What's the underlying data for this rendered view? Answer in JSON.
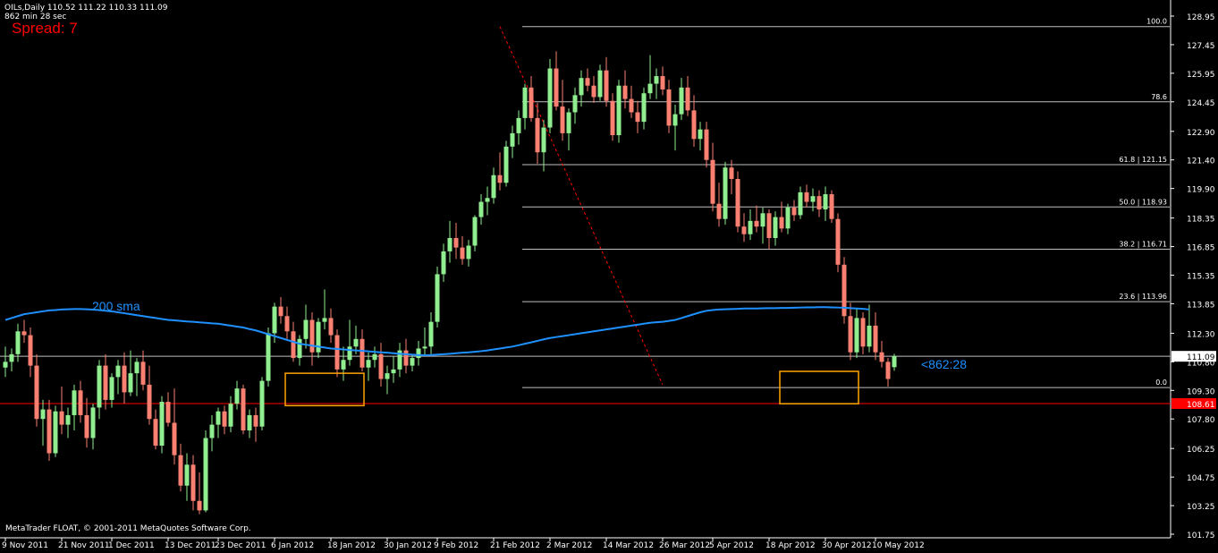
{
  "header": {
    "symbol_line": "OILs,Daily  110.52 111.22 110.33 111.09",
    "timer_line": "862 min 28 sec",
    "spread": "Spread: 7"
  },
  "footer": {
    "copyright": "MetaTrader FLOAT, © 2001-2011 MetaQuotes Software Corp."
  },
  "colors": {
    "background": "#000000",
    "axis": "#ffffff",
    "bull": "#90ee90",
    "bear": "#fa8072",
    "sma": "#1e90ff",
    "fib": "#c0c0c0",
    "trend": "#ff0000",
    "box": "#ffa500",
    "bid": "#c0c0c0",
    "ask_line": "#ff0000"
  },
  "chart_data": {
    "type": "candlestick",
    "symbol": "OILs",
    "timeframe": "Daily",
    "y_ticks": [
      "128.95",
      "127.45",
      "125.95",
      "124.45",
      "122.90",
      "121.40",
      "119.90",
      "118.35",
      "116.85",
      "115.35",
      "113.85",
      "112.30",
      "110.80",
      "109.30",
      "107.80",
      "106.25",
      "104.75",
      "103.25",
      "101.75"
    ],
    "ylim": [
      101.75,
      128.95
    ],
    "x_labels": [
      "9 Nov 2011",
      "21 Nov 2011",
      "1 Dec 2011",
      "13 Dec 2011",
      "23 Dec 2011",
      "6 Jan 2012",
      "18 Jan 2012",
      "30 Jan 2012",
      "9 Feb 2012",
      "21 Feb 2012",
      "2 Mar 2012",
      "14 Mar 2012",
      "26 Mar 2012",
      "5 Apr 2012",
      "18 Apr 2012",
      "30 Apr 2012",
      "10 May 2012"
    ],
    "x_label_index": [
      0,
      9,
      17,
      26,
      34,
      43,
      52,
      61,
      69,
      78,
      87,
      96,
      105,
      113,
      122,
      131,
      139
    ],
    "candles": [
      [
        110.5,
        111.6,
        110.0,
        110.8
      ],
      [
        110.8,
        111.5,
        110.3,
        111.2
      ],
      [
        111.2,
        112.8,
        110.8,
        112.4
      ],
      [
        112.4,
        113.0,
        111.8,
        112.2
      ],
      [
        112.2,
        112.6,
        110.0,
        110.6
      ],
      [
        110.6,
        111.2,
        107.4,
        107.8
      ],
      [
        107.8,
        108.8,
        106.4,
        108.3
      ],
      [
        108.3,
        108.8,
        105.6,
        106.0
      ],
      [
        106.0,
        108.5,
        105.8,
        108.2
      ],
      [
        108.2,
        109.5,
        107.0,
        107.5
      ],
      [
        107.5,
        108.4,
        106.8,
        108.0
      ],
      [
        108.0,
        109.6,
        107.2,
        109.3
      ],
      [
        109.3,
        109.8,
        107.6,
        108.0
      ],
      [
        108.0,
        108.9,
        106.3,
        106.8
      ],
      [
        106.8,
        108.6,
        106.2,
        108.4
      ],
      [
        108.4,
        110.9,
        107.8,
        110.6
      ],
      [
        110.6,
        111.2,
        108.3,
        108.8
      ],
      [
        108.8,
        110.2,
        108.4,
        110.0
      ],
      [
        110.0,
        110.9,
        109.1,
        110.6
      ],
      [
        110.6,
        111.3,
        108.6,
        109.2
      ],
      [
        109.2,
        111.4,
        109.0,
        110.2
      ],
      [
        110.2,
        111.0,
        109.0,
        110.8
      ],
      [
        110.8,
        111.4,
        109.3,
        109.6
      ],
      [
        109.6,
        110.6,
        107.5,
        107.8
      ],
      [
        107.8,
        108.3,
        106.2,
        106.4
      ],
      [
        106.4,
        109.0,
        106.0,
        108.7
      ],
      [
        108.7,
        109.2,
        107.4,
        107.6
      ],
      [
        107.6,
        109.4,
        105.4,
        105.9
      ],
      [
        105.9,
        106.5,
        104.0,
        104.3
      ],
      [
        104.3,
        106.0,
        103.5,
        105.4
      ],
      [
        105.4,
        105.9,
        103.0,
        103.5
      ],
      [
        103.5,
        105.0,
        102.8,
        103.0
      ],
      [
        103.0,
        107.2,
        102.9,
        106.8
      ],
      [
        106.8,
        108.0,
        106.1,
        107.5
      ],
      [
        107.5,
        108.4,
        106.8,
        108.2
      ],
      [
        108.2,
        108.5,
        107.0,
        107.4
      ],
      [
        107.4,
        109.0,
        107.1,
        108.6
      ],
      [
        108.6,
        109.8,
        108.3,
        109.4
      ],
      [
        109.4,
        109.6,
        107.0,
        107.2
      ],
      [
        107.2,
        108.3,
        106.8,
        108.0
      ],
      [
        108.0,
        108.4,
        106.6,
        107.4
      ],
      [
        107.4,
        110.0,
        107.2,
        109.8
      ],
      [
        109.8,
        112.6,
        109.5,
        112.3
      ],
      [
        112.3,
        113.9,
        111.8,
        113.7
      ],
      [
        113.7,
        114.2,
        112.8,
        113.2
      ],
      [
        113.2,
        113.7,
        112.0,
        112.4
      ],
      [
        112.4,
        112.9,
        110.8,
        111.0
      ],
      [
        111.0,
        112.2,
        110.6,
        112.0
      ],
      [
        112.0,
        113.8,
        111.5,
        113.0
      ],
      [
        113.0,
        113.4,
        110.6,
        111.3
      ],
      [
        111.3,
        113.1,
        111.0,
        112.9
      ],
      [
        112.9,
        114.6,
        112.5,
        113.1
      ],
      [
        113.1,
        113.6,
        111.8,
        112.2
      ],
      [
        112.2,
        112.5,
        110.0,
        110.4
      ],
      [
        110.4,
        111.6,
        109.8,
        110.9
      ],
      [
        110.9,
        113.0,
        110.6,
        111.6
      ],
      [
        111.6,
        112.7,
        111.2,
        112.0
      ],
      [
        112.0,
        112.5,
        110.3,
        110.5
      ],
      [
        110.5,
        111.3,
        109.8,
        110.9
      ],
      [
        110.9,
        111.6,
        110.5,
        111.2
      ],
      [
        111.2,
        111.8,
        109.5,
        109.9
      ],
      [
        109.9,
        110.6,
        109.1,
        110.2
      ],
      [
        110.2,
        111.1,
        109.7,
        110.4
      ],
      [
        110.4,
        111.8,
        110.0,
        111.4
      ],
      [
        111.4,
        112.0,
        110.2,
        110.6
      ],
      [
        110.6,
        111.2,
        110.3,
        111.0
      ],
      [
        111.0,
        111.9,
        110.6,
        111.5
      ],
      [
        111.5,
        112.6,
        111.1,
        111.6
      ],
      [
        111.6,
        113.4,
        111.2,
        112.9
      ],
      [
        112.9,
        115.8,
        112.6,
        115.4
      ],
      [
        115.4,
        117.0,
        115.0,
        116.6
      ],
      [
        116.6,
        118.2,
        116.0,
        117.3
      ],
      [
        117.3,
        118.1,
        116.2,
        116.8
      ],
      [
        116.8,
        117.4,
        115.9,
        116.2
      ],
      [
        116.2,
        117.2,
        115.8,
        116.9
      ],
      [
        116.9,
        118.5,
        116.6,
        118.4
      ],
      [
        118.4,
        119.6,
        118.0,
        119.2
      ],
      [
        119.2,
        120.0,
        118.5,
        119.4
      ],
      [
        119.4,
        121.0,
        119.1,
        120.6
      ],
      [
        120.6,
        121.8,
        119.8,
        120.2
      ],
      [
        120.2,
        122.4,
        120.0,
        122.1
      ],
      [
        122.1,
        123.2,
        121.5,
        122.8
      ],
      [
        122.8,
        124.0,
        122.2,
        123.6
      ],
      [
        123.6,
        125.4,
        123.0,
        125.2
      ],
      [
        125.2,
        125.8,
        123.4,
        123.6
      ],
      [
        123.6,
        124.4,
        121.2,
        121.8
      ],
      [
        121.8,
        123.5,
        120.8,
        123.1
      ],
      [
        123.1,
        126.7,
        122.8,
        126.2
      ],
      [
        126.2,
        127.1,
        124.0,
        124.2
      ],
      [
        124.2,
        125.6,
        122.4,
        122.8
      ],
      [
        122.8,
        124.1,
        121.9,
        123.9
      ],
      [
        123.9,
        125.2,
        123.3,
        124.8
      ],
      [
        124.8,
        126.1,
        124.2,
        125.7
      ],
      [
        125.7,
        126.2,
        125.0,
        125.3
      ],
      [
        125.3,
        125.8,
        124.4,
        124.7
      ],
      [
        124.7,
        126.4,
        124.5,
        126.1
      ],
      [
        126.1,
        126.8,
        124.2,
        124.5
      ],
      [
        124.5,
        124.9,
        122.4,
        122.7
      ],
      [
        122.7,
        125.6,
        122.3,
        125.3
      ],
      [
        125.3,
        126.1,
        124.1,
        124.6
      ],
      [
        124.6,
        125.3,
        123.6,
        123.9
      ],
      [
        123.9,
        124.5,
        122.8,
        123.4
      ],
      [
        123.4,
        125.2,
        123.0,
        124.9
      ],
      [
        124.9,
        126.9,
        124.6,
        125.4
      ],
      [
        125.4,
        126.2,
        124.6,
        125.8
      ],
      [
        125.8,
        126.3,
        124.8,
        125.1
      ],
      [
        125.1,
        125.6,
        122.8,
        123.2
      ],
      [
        123.2,
        124.3,
        121.9,
        123.8
      ],
      [
        123.8,
        125.7,
        123.5,
        125.2
      ],
      [
        125.2,
        125.8,
        123.7,
        124.0
      ],
      [
        124.0,
        124.8,
        122.1,
        122.5
      ],
      [
        122.5,
        123.4,
        121.9,
        123.0
      ],
      [
        123.0,
        123.4,
        121.0,
        121.4
      ],
      [
        121.4,
        122.3,
        118.7,
        119.1
      ],
      [
        119.1,
        120.2,
        117.9,
        118.3
      ],
      [
        118.3,
        121.3,
        118.0,
        121.0
      ],
      [
        121.0,
        121.4,
        119.6,
        120.4
      ],
      [
        120.4,
        120.8,
        117.6,
        117.9
      ],
      [
        117.9,
        118.6,
        117.1,
        117.5
      ],
      [
        117.5,
        118.8,
        117.2,
        118.2
      ],
      [
        118.2,
        119.0,
        117.6,
        117.9
      ],
      [
        117.9,
        118.9,
        117.0,
        118.6
      ],
      [
        118.6,
        118.8,
        116.7,
        117.3
      ],
      [
        117.3,
        118.7,
        116.9,
        118.4
      ],
      [
        118.4,
        119.2,
        117.6,
        117.8
      ],
      [
        117.8,
        119.1,
        117.5,
        118.9
      ],
      [
        118.9,
        119.3,
        118.2,
        118.5
      ],
      [
        118.5,
        120.0,
        118.3,
        119.7
      ],
      [
        119.7,
        120.1,
        118.9,
        119.2
      ],
      [
        119.2,
        119.9,
        118.7,
        119.5
      ],
      [
        119.5,
        119.8,
        118.4,
        118.8
      ],
      [
        118.8,
        120.0,
        118.2,
        119.6
      ],
      [
        119.6,
        119.8,
        118.1,
        118.3
      ],
      [
        118.3,
        118.6,
        115.5,
        115.9
      ],
      [
        115.9,
        116.3,
        112.8,
        113.2
      ],
      [
        113.2,
        113.9,
        110.9,
        111.3
      ],
      [
        111.3,
        113.6,
        111.0,
        113.1
      ],
      [
        113.1,
        113.4,
        111.2,
        111.6
      ],
      [
        111.6,
        113.8,
        111.3,
        112.7
      ],
      [
        112.7,
        113.4,
        110.9,
        111.3
      ],
      [
        111.3,
        111.9,
        110.5,
        110.8
      ],
      [
        110.8,
        111.0,
        109.5,
        109.9
      ],
      [
        110.52,
        111.22,
        110.33,
        111.09
      ]
    ],
    "sma": {
      "label": "200 sma",
      "values": [
        113.0,
        113.1,
        113.2,
        113.3,
        113.35,
        113.4,
        113.45,
        113.5,
        113.52,
        113.55,
        113.56,
        113.57,
        113.57,
        113.56,
        113.54,
        113.52,
        113.48,
        113.45,
        113.4,
        113.35,
        113.3,
        113.25,
        113.2,
        113.15,
        113.1,
        113.05,
        113.0,
        112.98,
        112.95,
        112.92,
        112.9,
        112.87,
        112.85,
        112.82,
        112.8,
        112.75,
        112.7,
        112.65,
        112.6,
        112.52,
        112.45,
        112.35,
        112.25,
        112.15,
        112.05,
        111.95,
        111.85,
        111.75,
        111.7,
        111.65,
        111.6,
        111.55,
        111.5,
        111.48,
        111.45,
        111.42,
        111.4,
        111.38,
        111.35,
        111.32,
        111.3,
        111.28,
        111.25,
        111.22,
        111.2,
        111.18,
        111.15,
        111.15,
        111.16,
        111.18,
        111.2,
        111.22,
        111.25,
        111.28,
        111.3,
        111.33,
        111.36,
        111.4,
        111.45,
        111.5,
        111.55,
        111.6,
        111.67,
        111.75,
        111.82,
        111.9,
        111.98,
        112.05,
        112.1,
        112.15,
        112.2,
        112.25,
        112.3,
        112.35,
        112.4,
        112.45,
        112.5,
        112.55,
        112.6,
        112.65,
        112.7,
        112.75,
        112.8,
        112.85,
        112.88,
        112.9,
        112.95,
        113.0,
        113.1,
        113.2,
        113.3,
        113.4,
        113.48,
        113.52,
        113.55,
        113.56,
        113.57,
        113.58,
        113.6,
        113.6,
        113.6,
        113.61,
        113.62,
        113.62,
        113.63,
        113.63,
        113.64,
        113.65,
        113.66,
        113.66,
        113.67,
        113.67,
        113.66,
        113.65,
        113.64,
        113.62,
        113.6,
        113.58,
        113.55
      ]
    },
    "fibonacci": [
      {
        "label": "100.0",
        "price": 128.4
      },
      {
        "label": "78.6",
        "price": 124.45
      },
      {
        "label": "61.8 | 121.15",
        "price": 121.15
      },
      {
        "label": "50.0 | 118.93",
        "price": 118.93
      },
      {
        "label": "38.2 | 116.71",
        "price": 116.71
      },
      {
        "label": "23.6 | 113.96",
        "price": 113.96
      },
      {
        "label": "0.0",
        "price": 109.45
      }
    ],
    "fib_start_index": 78,
    "trendline": {
      "from": [
        79,
        128.4
      ],
      "to": [
        105,
        109.6
      ]
    },
    "boxes": [
      {
        "start": 45,
        "end": 57,
        "high": 110.2,
        "low": 108.5
      },
      {
        "start": 124,
        "end": 136,
        "high": 110.3,
        "low": 108.6
      }
    ],
    "bid": "111.09",
    "bid_price": 111.09,
    "ask": "108.61",
    "ask_price": 108.61,
    "timer_label": "<862:28"
  }
}
